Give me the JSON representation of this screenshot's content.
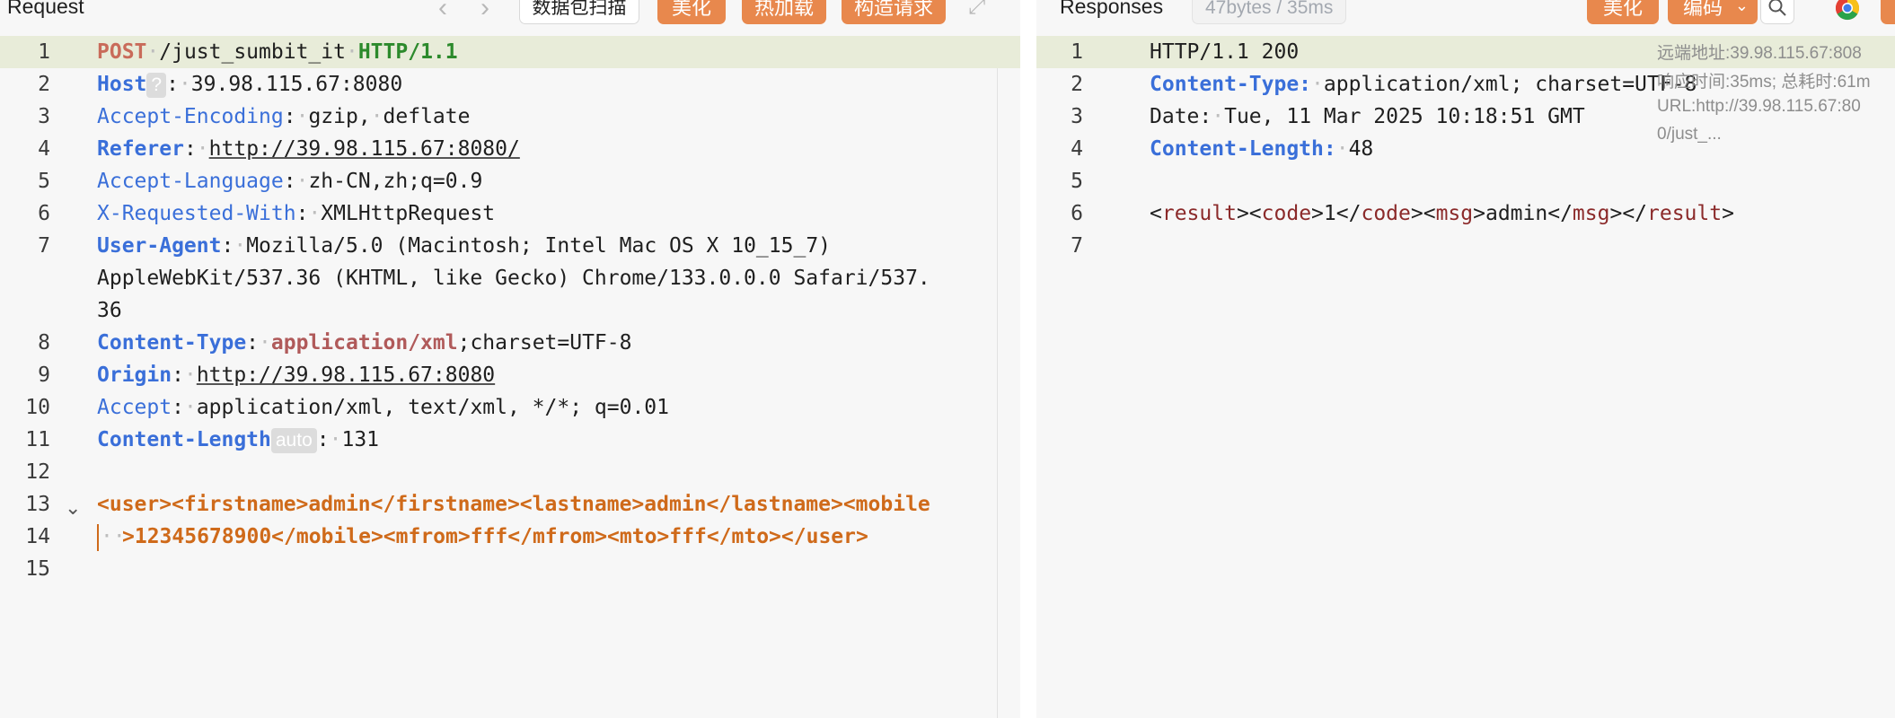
{
  "request": {
    "title": "Request",
    "buttons": {
      "scan": "数据包扫描",
      "beautify": "美化",
      "hot_load": "热加载",
      "construct": "构造请求"
    },
    "lines": {
      "l1": {
        "num": "1",
        "method": "POST",
        "path": "/just_sumbit_it",
        "version": "HTTP/1.1"
      },
      "l2": {
        "num": "2",
        "name": "Host",
        "chip": "?",
        "value": "39.98.115.67:8080"
      },
      "l3": {
        "num": "3",
        "name": "Accept-Encoding",
        "v1": "gzip,",
        "v2": "deflate"
      },
      "l4": {
        "num": "4",
        "name": "Referer",
        "value": "http://39.98.115.67:8080/"
      },
      "l5": {
        "num": "5",
        "name": "Accept-Language",
        "value": "zh-CN,zh;q=0.9"
      },
      "l6": {
        "num": "6",
        "name": "X-Requested-With",
        "value": "XMLHttpRequest"
      },
      "l7": {
        "num": "7",
        "name": "User-Agent",
        "value_a": "Mozilla/5.0 (Macintosh; Intel Mac OS X 10_15_7)",
        "value_b": "AppleWebKit/537.36 (KHTML, like Gecko) Chrome/133.0.0.0 Safari/537.",
        "value_c": "36"
      },
      "l8": {
        "num": "8",
        "name": "Content-Type",
        "ctype": "application/xml",
        "rest": ";charset=UTF-8"
      },
      "l9": {
        "num": "9",
        "name": "Origin",
        "value": "http://39.98.115.67:8080"
      },
      "l10": {
        "num": "10",
        "name": "Accept",
        "value": "application/xml, text/xml, */*; q=0.01"
      },
      "l11": {
        "num": "11",
        "name": "Content-Length",
        "chip": "auto",
        "value": "131"
      },
      "l12": {
        "num": "12"
      },
      "l13": {
        "num": "13",
        "body": "<user><firstname>admin</firstname><lastname>admin</lastname><mobile"
      },
      "l14": {
        "num": "14",
        "body": ">12345678900</mobile><mfrom>fff</mfrom><mto>fff</mto></user>"
      },
      "l15": {
        "num": "15"
      }
    }
  },
  "response": {
    "title": "Responses",
    "stats": "47bytes / 35ms",
    "buttons": {
      "beautify": "美化",
      "encode": "编码"
    },
    "info": {
      "remote": "远端地址:39.98.115.67:808",
      "timing": "响应时间:35ms; 总耗时:61m",
      "url_a": "URL:http://39.98.115.67:80",
      "url_b": "0/just_..."
    },
    "lines": {
      "l1": {
        "num": "1",
        "value": "HTTP/1.1 200"
      },
      "l2": {
        "num": "2",
        "name": "Content-Type:",
        "value": "application/xml; charset=UTF-8"
      },
      "l3": {
        "num": "3",
        "name": "Date:",
        "value": "Tue, 11 Mar 2025 10:18:51 GMT"
      },
      "l4": {
        "num": "4",
        "name": "Content-Length:",
        "value": "48"
      },
      "l5": {
        "num": "5"
      },
      "l6": {
        "num": "6",
        "t1": "result",
        "t2": "code",
        "v1": "1",
        "t3": "msg",
        "v2": "admin"
      },
      "l7": {
        "num": "7"
      }
    }
  },
  "icons": {
    "prev": "chevron-left-icon",
    "next": "chevron-right-icon",
    "expand": "expand-icon",
    "dropdown": "chevron-down-icon",
    "search": "search-icon",
    "chrome": "chrome-icon"
  }
}
